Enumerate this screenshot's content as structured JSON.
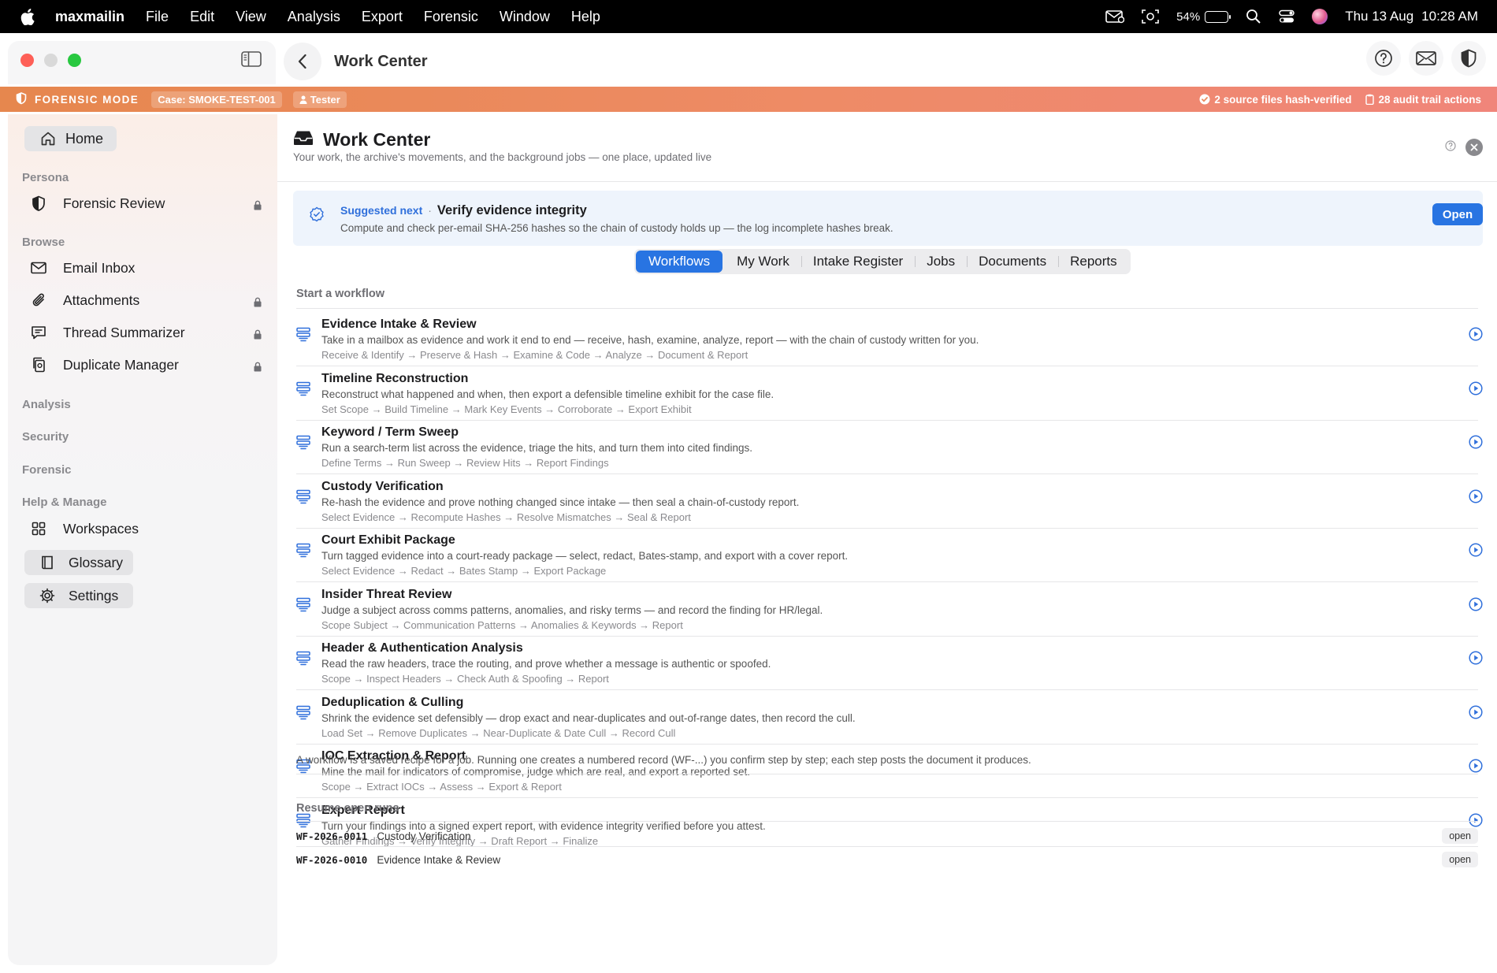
{
  "menubar": {
    "app_name": "maxmailin",
    "menus": [
      "File",
      "Edit",
      "View",
      "Analysis",
      "Export",
      "Forensic",
      "Window",
      "Help"
    ],
    "battery_percent": "54%",
    "battery_level": 0.54,
    "date": "Thu 13 Aug",
    "time": "10:28 AM"
  },
  "window": {
    "title": "Work Center"
  },
  "banner": {
    "mode_label": "FORENSIC MODE",
    "case_label": "Case: SMOKE-TEST-001",
    "user_label": "Tester",
    "hash_status": "2 source files hash-verified",
    "audit_status": "28 audit trail actions"
  },
  "sidebar": {
    "home_label": "Home",
    "sections": {
      "persona": "Persona",
      "browse": "Browse",
      "analysis": "Analysis",
      "security": "Security",
      "forensic": "Forensic",
      "help_manage": "Help & Manage"
    },
    "persona_items": [
      {
        "label": "Forensic Review",
        "icon": "shield-icon",
        "locked": true
      }
    ],
    "browse_items": [
      {
        "label": "Email Inbox",
        "icon": "envelope-icon",
        "locked": false
      },
      {
        "label": "Attachments",
        "icon": "paperclip-icon",
        "locked": true
      },
      {
        "label": "Thread Summarizer",
        "icon": "chat-icon",
        "locked": true
      },
      {
        "label": "Duplicate Manager",
        "icon": "copy-icon",
        "locked": true
      }
    ],
    "manage_items": [
      {
        "label": "Workspaces",
        "icon": "grid-icon"
      },
      {
        "label": "Glossary",
        "icon": "book-icon"
      },
      {
        "label": "Settings",
        "icon": "gear-icon"
      }
    ]
  },
  "main": {
    "title": "Work Center",
    "subtitle": "Your work, the archive's movements, and the background jobs — one place, updated live",
    "suggestion": {
      "kicker": "Suggested next",
      "separator": "·",
      "title": "Verify evidence integrity",
      "description": "Compute and check per-email SHA-256 hashes so the chain of custody holds up — the log incomplete hashes break.",
      "button_label": "Open"
    },
    "tabs": [
      "Workflows",
      "My Work",
      "Intake Register",
      "Jobs",
      "Documents",
      "Reports"
    ],
    "active_tab": "Workflows",
    "start_label": "Start a workflow",
    "workflows": [
      {
        "name": "Evidence Intake & Review",
        "description": "Take in a mailbox as evidence and work it end to end — receive, hash, examine, analyze, report — with the chain of custody written for you.",
        "steps": "Receive & Identify → Preserve & Hash → Examine & Code → Analyze → Document & Report"
      },
      {
        "name": "Timeline Reconstruction",
        "description": "Reconstruct what happened and when, then export a defensible timeline exhibit for the case file.",
        "steps": "Set Scope → Build Timeline → Mark Key Events → Corroborate → Export Exhibit"
      },
      {
        "name": "Keyword / Term Sweep",
        "description": "Run a search-term list across the evidence, triage the hits, and turn them into cited findings.",
        "steps": "Define Terms → Run Sweep → Review Hits → Report Findings"
      },
      {
        "name": "Custody Verification",
        "description": "Re-hash the evidence and prove nothing changed since intake — then seal a chain-of-custody report.",
        "steps": "Select Evidence → Recompute Hashes → Resolve Mismatches → Seal & Report"
      },
      {
        "name": "Court Exhibit Package",
        "description": "Turn tagged evidence into a court-ready package — select, redact, Bates-stamp, and export with a cover report.",
        "steps": "Select Evidence → Redact → Bates Stamp → Export Package"
      },
      {
        "name": "Insider Threat Review",
        "description": "Judge a subject across comms patterns, anomalies, and risky terms — and record the finding for HR/legal.",
        "steps": "Scope Subject → Communication Patterns → Anomalies & Keywords → Report"
      },
      {
        "name": "Header & Authentication Analysis",
        "description": "Read the raw headers, trace the routing, and prove whether a message is authentic or spoofed.",
        "steps": "Scope → Inspect Headers → Check Auth & Spoofing → Report"
      },
      {
        "name": "Deduplication & Culling",
        "description": "Shrink the evidence set defensibly — drop exact and near-duplicates and out-of-range dates, then record the cull.",
        "steps": "Load Set → Remove Duplicates → Near-Duplicate & Date Cull → Record Cull"
      },
      {
        "name": "IOC Extraction & Report",
        "description": "Mine the mail for indicators of compromise, judge which are real, and export a reported set.",
        "steps": "Scope → Extract IOCs → Assess → Export & Report"
      },
      {
        "name": "Expert Report",
        "description": "Turn your findings into a signed expert report, with evidence integrity verified before you attest.",
        "steps": "Gather Findings → Verify Integrity → Draft Report → Finalize"
      }
    ],
    "footnote": "A workflow is a saved recipe for a job. Running one creates a numbered record (WF-...) you confirm step by step; each step posts the document it produces.",
    "resume_label": "Resume open runs",
    "open_runs": [
      {
        "id": "WF-2026-0011",
        "name": "Custody Verification",
        "status": "open"
      },
      {
        "id": "WF-2026-0010",
        "name": "Evidence Intake & Review",
        "status": "open"
      }
    ]
  },
  "colors": {
    "accent": "#2874e2",
    "banner_start": "#e6874e",
    "banner_end": "#f0857a",
    "suggestion_bg": "#eef4fc"
  }
}
